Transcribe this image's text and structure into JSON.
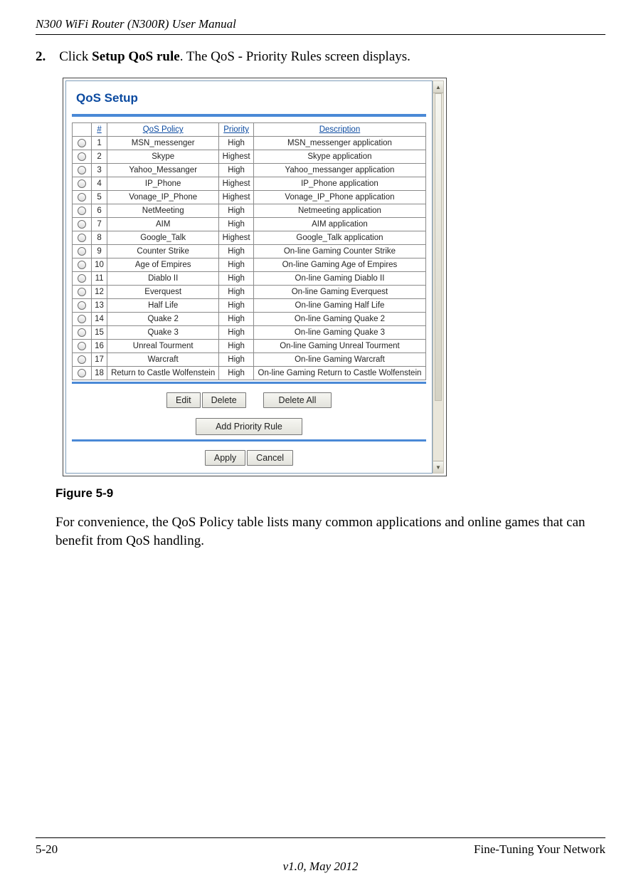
{
  "doc": {
    "header": "N300 WiFi Router (N300R) User Manual",
    "step_number": "2.",
    "step_prefix": "Click ",
    "step_bold": "Setup QoS rule",
    "step_suffix": ". The QoS - Priority Rules screen displays.",
    "figure_label": "Figure 5-9",
    "body_para": "For convenience, the QoS Policy table lists many common applications and online games that can benefit from QoS handling.",
    "page_num": "5-20",
    "footer_right": "Fine-Tuning Your Network",
    "version": "v1.0, May 2012"
  },
  "ui": {
    "title": "QoS Setup",
    "headers": {
      "num": "#",
      "policy": "QoS Policy",
      "priority": "Priority",
      "desc": "Description"
    },
    "rows": [
      {
        "n": "1",
        "policy": "MSN_messenger",
        "priority": "High",
        "desc": "MSN_messenger application"
      },
      {
        "n": "2",
        "policy": "Skype",
        "priority": "Highest",
        "desc": "Skype application"
      },
      {
        "n": "3",
        "policy": "Yahoo_Messanger",
        "priority": "High",
        "desc": "Yahoo_messanger application"
      },
      {
        "n": "4",
        "policy": "IP_Phone",
        "priority": "Highest",
        "desc": "IP_Phone application"
      },
      {
        "n": "5",
        "policy": "Vonage_IP_Phone",
        "priority": "Highest",
        "desc": "Vonage_IP_Phone application"
      },
      {
        "n": "6",
        "policy": "NetMeeting",
        "priority": "High",
        "desc": "Netmeeting application"
      },
      {
        "n": "7",
        "policy": "AIM",
        "priority": "High",
        "desc": "AIM application"
      },
      {
        "n": "8",
        "policy": "Google_Talk",
        "priority": "Highest",
        "desc": "Google_Talk application"
      },
      {
        "n": "9",
        "policy": "Counter Strike",
        "priority": "High",
        "desc": "On-line Gaming Counter Strike"
      },
      {
        "n": "10",
        "policy": "Age of Empires",
        "priority": "High",
        "desc": "On-line Gaming Age of Empires"
      },
      {
        "n": "11",
        "policy": "Diablo II",
        "priority": "High",
        "desc": "On-line Gaming Diablo II"
      },
      {
        "n": "12",
        "policy": "Everquest",
        "priority": "High",
        "desc": "On-line Gaming Everquest"
      },
      {
        "n": "13",
        "policy": "Half Life",
        "priority": "High",
        "desc": "On-line Gaming Half Life"
      },
      {
        "n": "14",
        "policy": "Quake 2",
        "priority": "High",
        "desc": "On-line Gaming Quake 2"
      },
      {
        "n": "15",
        "policy": "Quake 3",
        "priority": "High",
        "desc": "On-line Gaming Quake 3"
      },
      {
        "n": "16",
        "policy": "Unreal Tourment",
        "priority": "High",
        "desc": "On-line Gaming Unreal Tourment"
      },
      {
        "n": "17",
        "policy": "Warcraft",
        "priority": "High",
        "desc": "On-line Gaming Warcraft"
      },
      {
        "n": "18",
        "policy": "Return to Castle Wolfenstein",
        "priority": "High",
        "desc": "On-line Gaming Return to Castle Wolfenstein"
      }
    ],
    "buttons": {
      "edit": "Edit",
      "delete": "Delete",
      "delete_all": "Delete All",
      "add_rule": "Add Priority Rule",
      "apply": "Apply",
      "cancel": "Cancel"
    }
  }
}
